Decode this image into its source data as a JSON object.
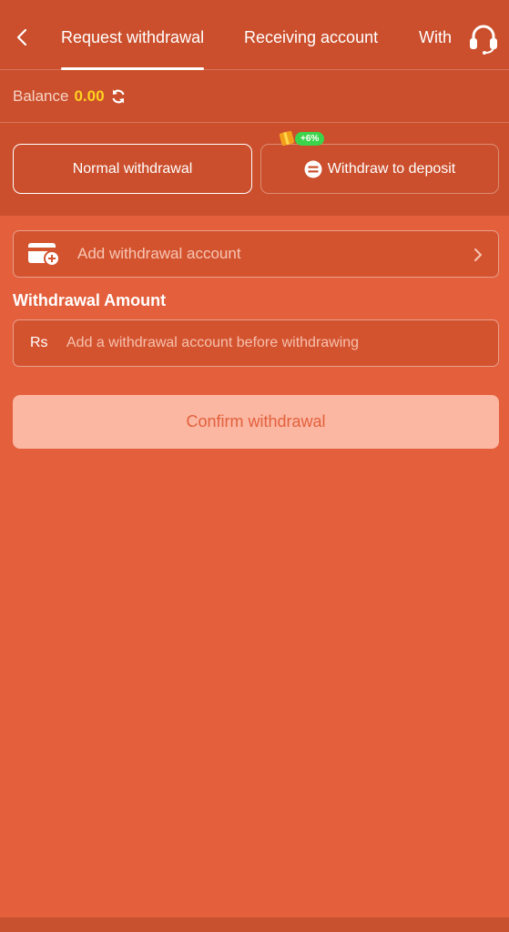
{
  "nav": {
    "tabs": [
      {
        "label": "Request withdrawal",
        "active": true
      },
      {
        "label": "Receiving account",
        "active": false
      },
      {
        "label": "With",
        "active": false
      }
    ],
    "back_icon": "chevron-left-icon",
    "support_icon": "headset-icon"
  },
  "balance": {
    "label": "Balance",
    "value": "0.00",
    "refresh_icon": "refresh-icon"
  },
  "modes": {
    "normal_label": "Normal withdrawal",
    "deposit_label": "Withdraw to deposit",
    "bonus_badge": "+6%"
  },
  "account": {
    "label": "Add withdrawal account",
    "icon": "wallet-add-icon"
  },
  "amount": {
    "title": "Withdrawal Amount",
    "currency": "Rs",
    "placeholder": "Add a withdrawal account before withdrawing"
  },
  "confirm_label": "Confirm withdrawal",
  "colors": {
    "background": "#e4603d",
    "header": "#cb4f2c",
    "balance_value": "#ffd21f",
    "confirm_button": "#fbb7a2",
    "bonus_badge": "#3bd44a"
  }
}
